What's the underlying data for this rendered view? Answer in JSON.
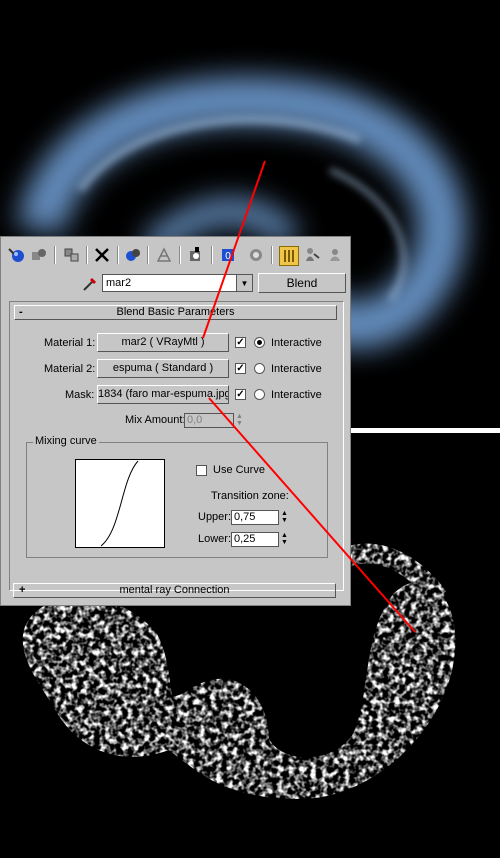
{
  "toolbar": {
    "icons": [
      "get-material-icon",
      "put-to-scene-icon",
      "assign-to-selection-icon",
      "reset-icon",
      "make-unique-icon",
      "put-to-library-icon",
      "material-id-icon",
      "show-map-icon",
      "show-end-result-icon",
      "go-to-parent-icon",
      "go-forward-icon"
    ]
  },
  "namebar": {
    "material_name": "mar2",
    "type_label": "Blend"
  },
  "rollout": {
    "sign": "-",
    "title": "Blend Basic Parameters"
  },
  "material1": {
    "label": "Material 1:",
    "value": "mar2  ( VRayMtl )",
    "checked": true,
    "interactive_label": "Interactive",
    "interactive_on": true
  },
  "material2": {
    "label": "Material 2:",
    "value": "espuma  ( Standard )",
    "checked": true,
    "interactive_label": "Interactive",
    "interactive_on": false
  },
  "mask": {
    "label": "Mask:",
    "value": "1834 (faro mar-espuma.jpg)",
    "checked": true,
    "interactive_label": "Interactive",
    "interactive_on": false
  },
  "mix_amount": {
    "label": "Mix Amount:",
    "value": "0,0"
  },
  "mixing_curve": {
    "title": "Mixing curve",
    "use_curve_label": "Use Curve",
    "use_curve_checked": false,
    "transition_label": "Transition zone:",
    "upper_label": "Upper:",
    "upper_value": "0,75",
    "lower_label": "Lower:",
    "lower_value": "0,25"
  },
  "rollout2": {
    "sign": "+",
    "title": "mental ray Connection"
  },
  "colors": {
    "panel_bg": "#c6c6c6",
    "annotation_line": "#ff0000",
    "render_blue": "#6f9bd1"
  }
}
